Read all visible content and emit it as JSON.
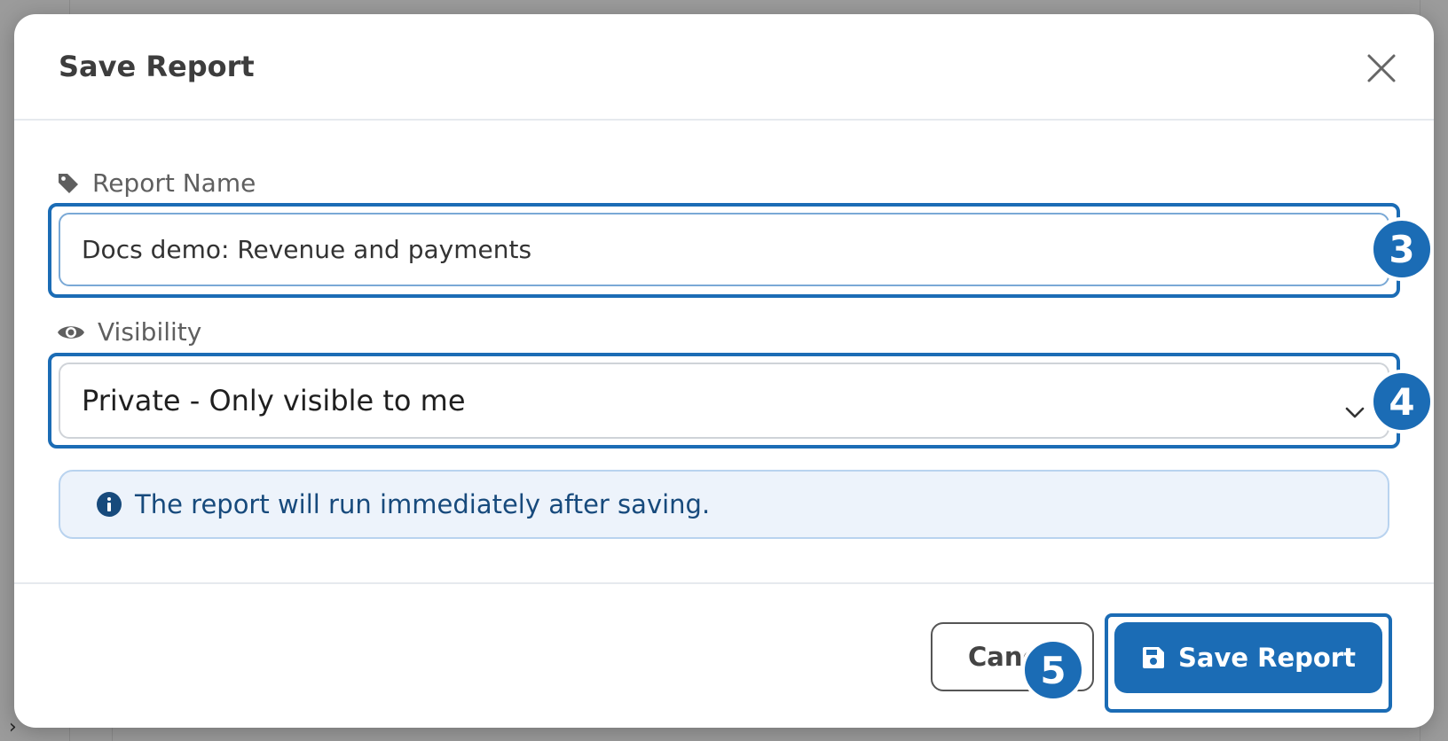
{
  "dialog": {
    "title": "Save Report"
  },
  "fields": {
    "report_name": {
      "label": "Report Name",
      "value": "Docs demo: Revenue and payments"
    },
    "visibility": {
      "label": "Visibility",
      "selected": "Private - Only visible to me"
    }
  },
  "info": {
    "message": "The report will run immediately after saving."
  },
  "footer": {
    "cancel_label": "Cancel",
    "save_label": "Save Report"
  },
  "step_badges": {
    "name_step": "3",
    "visibility_step": "4",
    "save_step": "5"
  },
  "colors": {
    "accent": "#1b6cb5",
    "info_bg": "#edf3fb",
    "info_text": "#174a7c"
  },
  "icons": {
    "label_name": "tag-icon",
    "label_visibility": "eye-icon",
    "info": "info-circle-icon",
    "save": "floppy-disk-icon",
    "close": "close-icon",
    "select": "chevron-down-icon"
  }
}
